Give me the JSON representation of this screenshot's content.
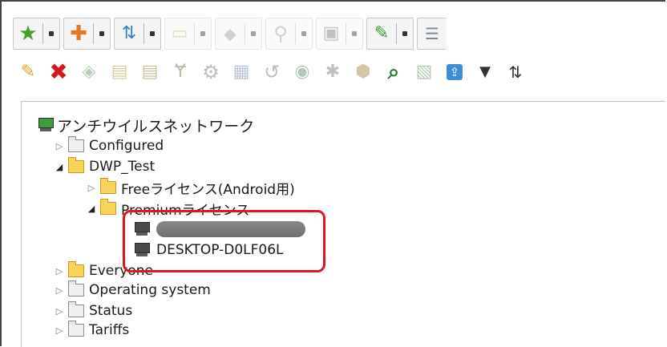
{
  "toolbar": {
    "row1": [
      {
        "icon": "star-icon",
        "glyph": "★",
        "color": "#4a9c2e"
      },
      {
        "icon": "plus-icon",
        "glyph": "✚",
        "color": "#e87722"
      },
      {
        "icon": "arrows-icon",
        "glyph": "⇅",
        "color": "#3a7fd0"
      },
      {
        "icon": "folder-icon",
        "glyph": "▭",
        "color": "#c9c9c9"
      },
      {
        "icon": "box-icon",
        "glyph": "◆",
        "color": "#bdbdbd"
      },
      {
        "icon": "search-icon",
        "glyph": "⚲",
        "color": "#bdbdbd"
      },
      {
        "icon": "monitor-icon",
        "glyph": "▣",
        "color": "#aaaaaa"
      },
      {
        "icon": "edit-icon",
        "glyph": "✎",
        "color": "#3a9c3a"
      },
      {
        "icon": "list-icon",
        "glyph": "☰",
        "color": "#7a8a9a"
      }
    ],
    "row2": [
      {
        "icon": "pencil-icon",
        "glyph": "✎",
        "color": "#e0a030"
      },
      {
        "icon": "delete-icon",
        "glyph": "✖",
        "color": "#d11a1a"
      },
      {
        "icon": "tag-icon",
        "glyph": "◈",
        "color": "#8fa88f"
      },
      {
        "icon": "card-icon",
        "glyph": "▤",
        "color": "#cbb56a"
      },
      {
        "icon": "card-icon-2",
        "glyph": "▤",
        "color": "#b5a04a"
      },
      {
        "icon": "merge-icon",
        "glyph": "Ɏ",
        "color": "#9a9a6a"
      },
      {
        "icon": "gear-icon",
        "glyph": "⚙",
        "color": "#a0a0a0"
      },
      {
        "icon": "send-icon",
        "glyph": "▦",
        "color": "#9aa9c2"
      },
      {
        "icon": "undo-icon",
        "glyph": "↺",
        "color": "#a0a0a0"
      },
      {
        "icon": "scan-icon",
        "glyph": "◉",
        "color": "#9ab09a"
      },
      {
        "icon": "virus-icon",
        "glyph": "✱",
        "color": "#a0a0a0"
      },
      {
        "icon": "shield-icon",
        "glyph": "⬢",
        "color": "#c0b080"
      },
      {
        "icon": "inspect-icon",
        "glyph": "⌕",
        "color": "#3c8a3c"
      },
      {
        "icon": "report-icon",
        "glyph": "▧",
        "color": "#8aa88a"
      },
      {
        "icon": "upload-icon",
        "glyph": "⇪",
        "color": "#3a7fd0"
      },
      {
        "icon": "filter-icon",
        "glyph": "▼",
        "color": "#333333"
      },
      {
        "icon": "sort-icon",
        "glyph": "⇅",
        "color": "#333333"
      }
    ]
  },
  "tree": {
    "root": "アンチウイルスネットワーク",
    "configured": "Configured",
    "dwp_test": "DWP_Test",
    "free_license": "Freeライセンス(Android用)",
    "premium_license": "Premiumライセンス",
    "desktop": "DESKTOP-D0LF06L",
    "everyone": "Everyone",
    "operating_system": "Operating system",
    "status": "Status",
    "tariffs": "Tariffs"
  },
  "colors": {
    "highlight": "#e0161d"
  }
}
